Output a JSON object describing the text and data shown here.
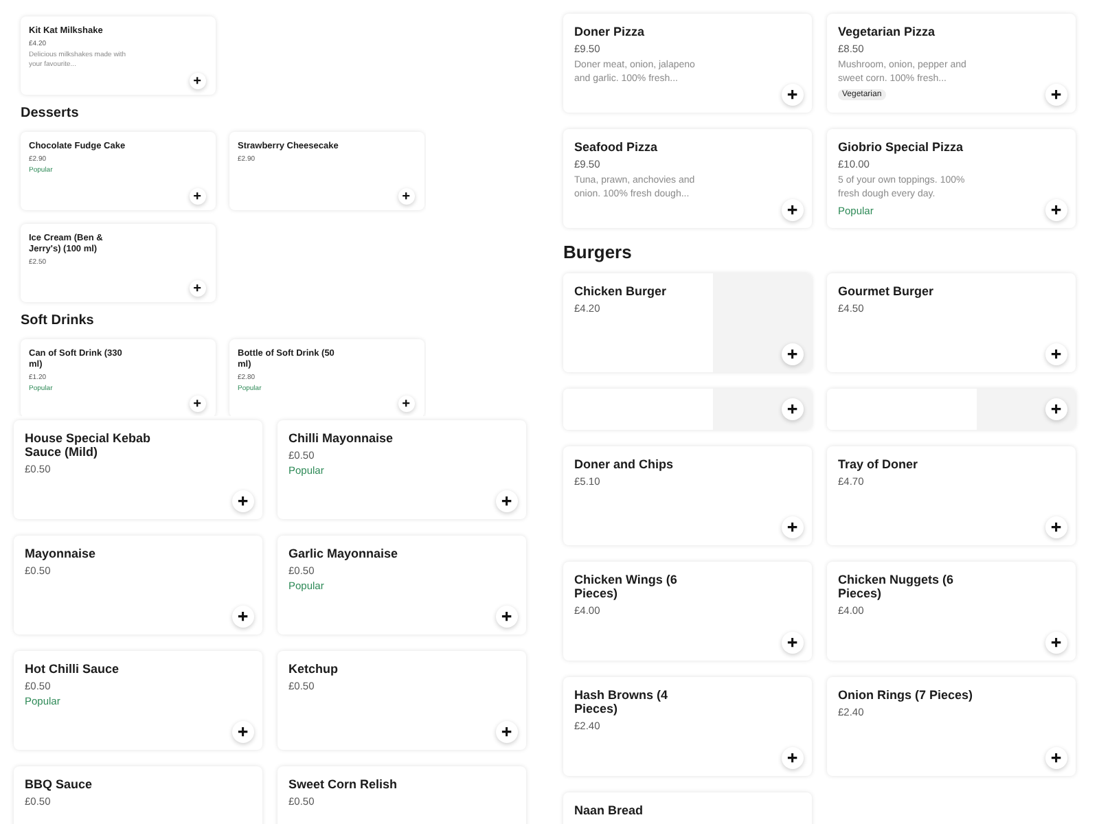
{
  "panels": [
    {
      "kind": "compact",
      "sections": [
        {
          "items": [
            {
              "kind": "item",
              "photo": false,
              "name": "Kit Kat Milkshake",
              "price": "£4.20",
              "description": "Delicious milkshakes made with your favourite..."
            }
          ]
        },
        {
          "heading": "Desserts",
          "items": [
            {
              "kind": "item",
              "photo": false,
              "name": "Chocolate Fudge Cake",
              "price": "£2.90",
              "badge": "Popular"
            },
            {
              "kind": "item",
              "photo": false,
              "name": "Strawberry Cheesecake",
              "price": "£2.90"
            },
            {
              "kind": "item",
              "photo": false,
              "name": "Ice Cream (Ben & Jerry's) (100 ml)",
              "price": "£2.50"
            }
          ]
        },
        {
          "heading": "Soft Drinks",
          "items": [
            {
              "kind": "item",
              "photo": false,
              "name": "Can of Soft Drink (330 ml)",
              "price": "£1.20",
              "badge": "Popular"
            },
            {
              "kind": "item",
              "photo": false,
              "name": "Bottle of Soft Drink (50 ml)",
              "price": "£2.80",
              "badge": "Popular"
            }
          ]
        }
      ]
    },
    {
      "kind": "regular",
      "sections": [
        {
          "items": [
            {
              "kind": "item",
              "photo": false,
              "name": "House Special Kebab Sauce (Mild)",
              "price": "£0.50"
            },
            {
              "kind": "item",
              "photo": false,
              "name": "Chilli Mayonnaise",
              "price": "£0.50",
              "badge": "Popular"
            },
            {
              "kind": "item",
              "photo": false,
              "name": "Mayonnaise",
              "price": "£0.50"
            },
            {
              "kind": "item",
              "photo": false,
              "name": "Garlic Mayonnaise",
              "price": "£0.50",
              "badge": "Popular"
            },
            {
              "kind": "item",
              "photo": false,
              "name": "Hot Chilli Sauce",
              "price": "£0.50",
              "badge": "Popular"
            },
            {
              "kind": "item",
              "photo": false,
              "name": "Ketchup",
              "price": "£0.50"
            },
            {
              "kind": "item",
              "photo": false,
              "name": "BBQ Sauce",
              "price": "£0.50"
            },
            {
              "kind": "item",
              "photo": false,
              "name": "Sweet Corn Relish",
              "price": "£0.50"
            }
          ]
        }
      ]
    },
    {
      "kind": "regular",
      "sections": [
        {
          "items": [
            {
              "kind": "item",
              "photo": false,
              "name": "Doner Pizza",
              "price": "£9.50",
              "description": "Doner meat, onion, jalapeno and garlic. 100% fresh..."
            },
            {
              "kind": "item",
              "photo": false,
              "name": "Vegetarian Pizza",
              "price": "£8.50",
              "description": "Mushroom, onion, pepper and sweet corn. 100% fresh...",
              "tag": "Vegetarian"
            },
            {
              "kind": "item",
              "photo": false,
              "name": "Seafood Pizza",
              "price": "£9.50",
              "description": "Tuna, prawn, anchovies and onion. 100% fresh dough..."
            },
            {
              "kind": "item",
              "photo": false,
              "name": "Giobrio Special Pizza",
              "price": "£10.00",
              "description": "5 of your own toppings. 100% fresh dough every day.",
              "badge": "Popular"
            }
          ]
        },
        {
          "heading": "Burgers",
          "items": [
            {
              "kind": "item",
              "photo": true,
              "name": "Chicken Burger",
              "price": "£4.20"
            },
            {
              "kind": "item",
              "photo": false,
              "name": "Gourmet Burger",
              "price": "£4.50"
            },
            {
              "kind": "clipped",
              "photo": true
            },
            {
              "kind": "clipped",
              "photo": true
            },
            {
              "kind": "item",
              "photo": false,
              "name": "Doner and Chips",
              "price": "£5.10"
            },
            {
              "kind": "item",
              "photo": false,
              "name": "Tray of Doner",
              "price": "£4.70"
            },
            {
              "kind": "item",
              "photo": false,
              "name": "Chicken Wings (6 Pieces)",
              "price": "£4.00"
            },
            {
              "kind": "item",
              "photo": false,
              "name": "Chicken Nuggets (6 Pieces)",
              "price": "£4.00"
            },
            {
              "kind": "item",
              "photo": false,
              "name": "Hash Browns (4 Pieces)",
              "price": "£2.40"
            },
            {
              "kind": "item",
              "photo": false,
              "name": "Onion Rings (7 Pieces)",
              "price": "£2.40"
            },
            {
              "kind": "item",
              "photo": false,
              "name": "Naan Bread"
            }
          ]
        }
      ]
    }
  ]
}
